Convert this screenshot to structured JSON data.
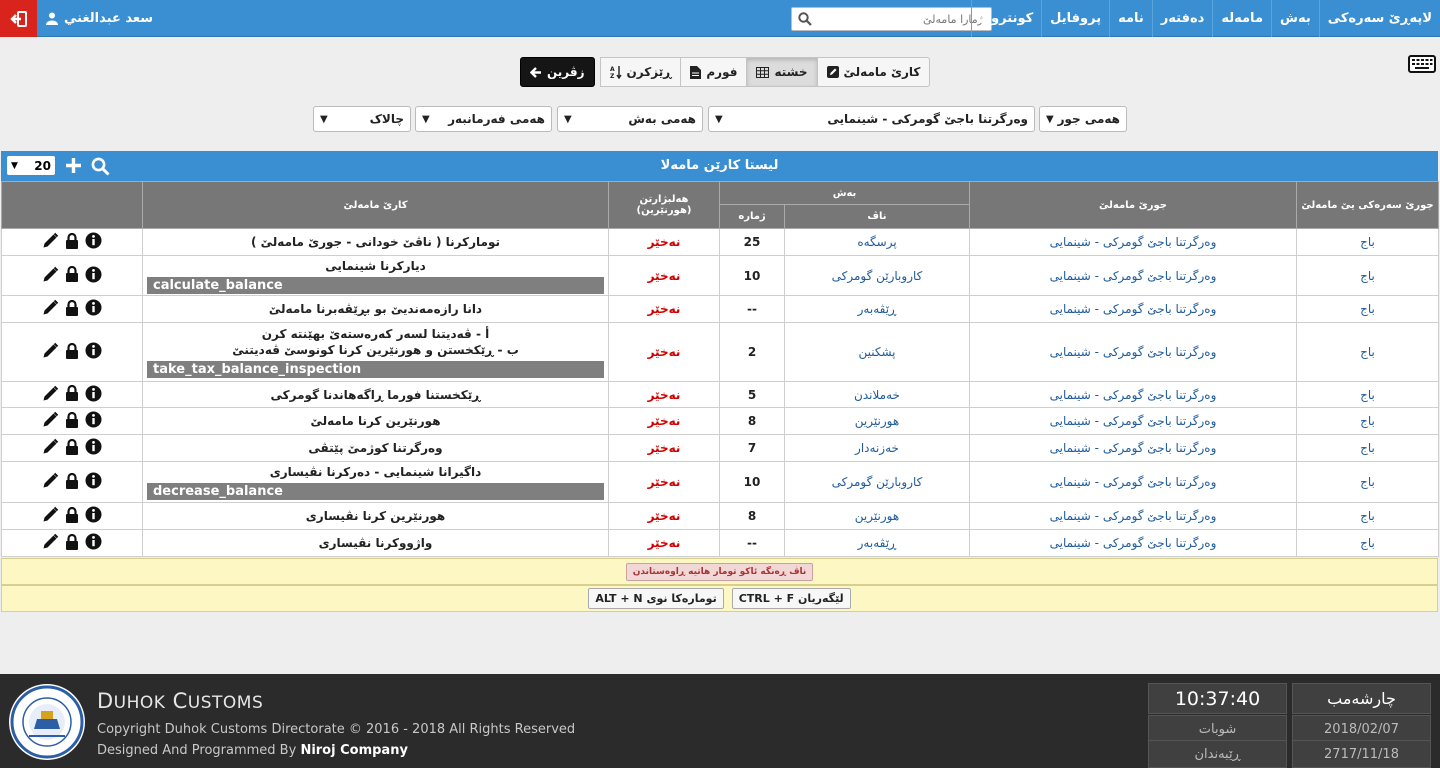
{
  "user": {
    "name": "سعد عبدالغني"
  },
  "nav": {
    "items": [
      "لاپەڕێ سەرەکی",
      "بەش",
      "مامەلە",
      "دەفتەر",
      "نامە",
      "پروفایل",
      "کونترول"
    ],
    "search_placeholder": "ژمارا مامەلێ"
  },
  "toolbar": {
    "back": "زڤرین",
    "sort": "ڕێزکرن",
    "form": "فورم",
    "grid": "خشتە",
    "work": "کارێ مامەلێ"
  },
  "filters": {
    "type": "هەمی جور",
    "kind": "وەرگرتنا باجێ گومرکی - شینمایی",
    "dept": "هەمی بەش",
    "employee": "هەمی فەرمانبەر",
    "status": "چالاک"
  },
  "panel": {
    "title": "لیستا کارێن مامەلا",
    "page_size": "20"
  },
  "table": {
    "headers": {
      "main_type": "جورێ سەرەکی یێ مامەلێ",
      "kind": "جورێ مامەلێ",
      "dept": "بەش",
      "dept_name": "ناڤ",
      "dept_num": "ژمارە",
      "status": "هەلبژارتن (هورنێرین)",
      "work": "کارێ مامەلێ"
    },
    "rows": [
      {
        "type": "باج",
        "kind": "وەرگرتنا باجێ گومرکی - شینمایی",
        "name": "پرسگەه",
        "num": "25",
        "status": "نەخێر",
        "desc": [
          "تومارکرنا ( ناڤێ خودانی - جورێ مامەلێ )"
        ],
        "func": ""
      },
      {
        "type": "باج",
        "kind": "وەرگرتنا باجێ گومرکی - شینمایی",
        "name": "کاروبارێن گومرکی",
        "num": "10",
        "status": "نەخێر",
        "desc": [
          "دیارکرنا شینمایی"
        ],
        "func": "calculate_balance"
      },
      {
        "type": "باج",
        "kind": "وەرگرتنا باجێ گومرکی - شینمایی",
        "name": "ڕێڤەبەر",
        "num": "--",
        "status": "نەخێر",
        "desc": [
          "دانا رازەمەندیێ بو بڕێڤەبرنا مامەلێ"
        ],
        "func": ""
      },
      {
        "type": "باج",
        "kind": "وەرگرتنا باجێ گومرکی - شینمایی",
        "name": "پشکنین",
        "num": "2",
        "status": "نەخێر",
        "desc": [
          "أ - ڤەدیتنا لسەر کەرەستەێ بهێنتە کرن",
          "ب - ڕێکخستن و هورنێرین کرنا کونوسێ ڤەدیتنێ"
        ],
        "func": "take_tax_balance_inspection"
      },
      {
        "type": "باج",
        "kind": "وەرگرتنا باجێ گومرکی - شینمایی",
        "name": "خەملاندن",
        "num": "5",
        "status": "نەخێر",
        "desc": [
          "ڕێکخستنا فورما ڕاگەهاندنا گومرکی"
        ],
        "func": ""
      },
      {
        "type": "باج",
        "kind": "وەرگرتنا باجێ گومرکی - شینمایی",
        "name": "هورنێرین",
        "num": "8",
        "status": "نەخێر",
        "desc": [
          "هورنێرین کرنا مامەلێ"
        ],
        "func": ""
      },
      {
        "type": "باج",
        "kind": "وەرگرتنا باجێ گومرکی - شینمایی",
        "name": "خەزنەدار",
        "num": "7",
        "status": "نەخێر",
        "desc": [
          "وەرگرتنا کوژمێ پێتڤی"
        ],
        "func": ""
      },
      {
        "type": "باج",
        "kind": "وەرگرتنا باجێ گومرکی - شینمایی",
        "name": "کاروبارێن گومرکی",
        "num": "10",
        "status": "نەخێر",
        "desc": [
          "داگیرانا شینمایی - دەرکرنا نڤیساری"
        ],
        "func": "decrease_balance"
      },
      {
        "type": "باج",
        "kind": "وەرگرتنا باجێ گومرکی - شینمایی",
        "name": "هورنێرین",
        "num": "8",
        "status": "نەخێر",
        "desc": [
          "هورنێرین کرنا نڤیساری"
        ],
        "func": ""
      },
      {
        "type": "باج",
        "kind": "وەرگرتنا باجێ گومرکی - شینمایی",
        "name": "ڕێڤەبەر",
        "num": "--",
        "status": "نەخێر",
        "desc": [
          "واژووکرنا نڤیساری"
        ],
        "func": ""
      }
    ]
  },
  "hints": {
    "warning": "ناڤ ڕەنگە ئاکو تومار هاتیە ڕاوەستاندن",
    "new_key": "ALT + N",
    "new_label": "تومارەکا نوی",
    "find_key": "CTRL + F",
    "find_label": "لێگەریان"
  },
  "footer": {
    "brand_first": "D",
    "brand_rest": "UHOK",
    "brand_first2": "C",
    "brand_rest2": "USTOMS",
    "copyright": "Copyright Duhok Customs Directorate © 2016 - 2018 All Rights Reserved",
    "designed": "Designed And Programmed By",
    "company": "Niroj Company",
    "day": "چارشەمب",
    "time": "10:37:40",
    "gregorian_date": "2018/02/07",
    "month": "شوبات",
    "kurdish_date": "2717/11/18",
    "kurdish_month": "ڕێبەندان"
  },
  "colors": {
    "accent": "#3a8fd2",
    "logout": "#d9241d",
    "status": "#d10000",
    "link": "#1f5b9a"
  }
}
